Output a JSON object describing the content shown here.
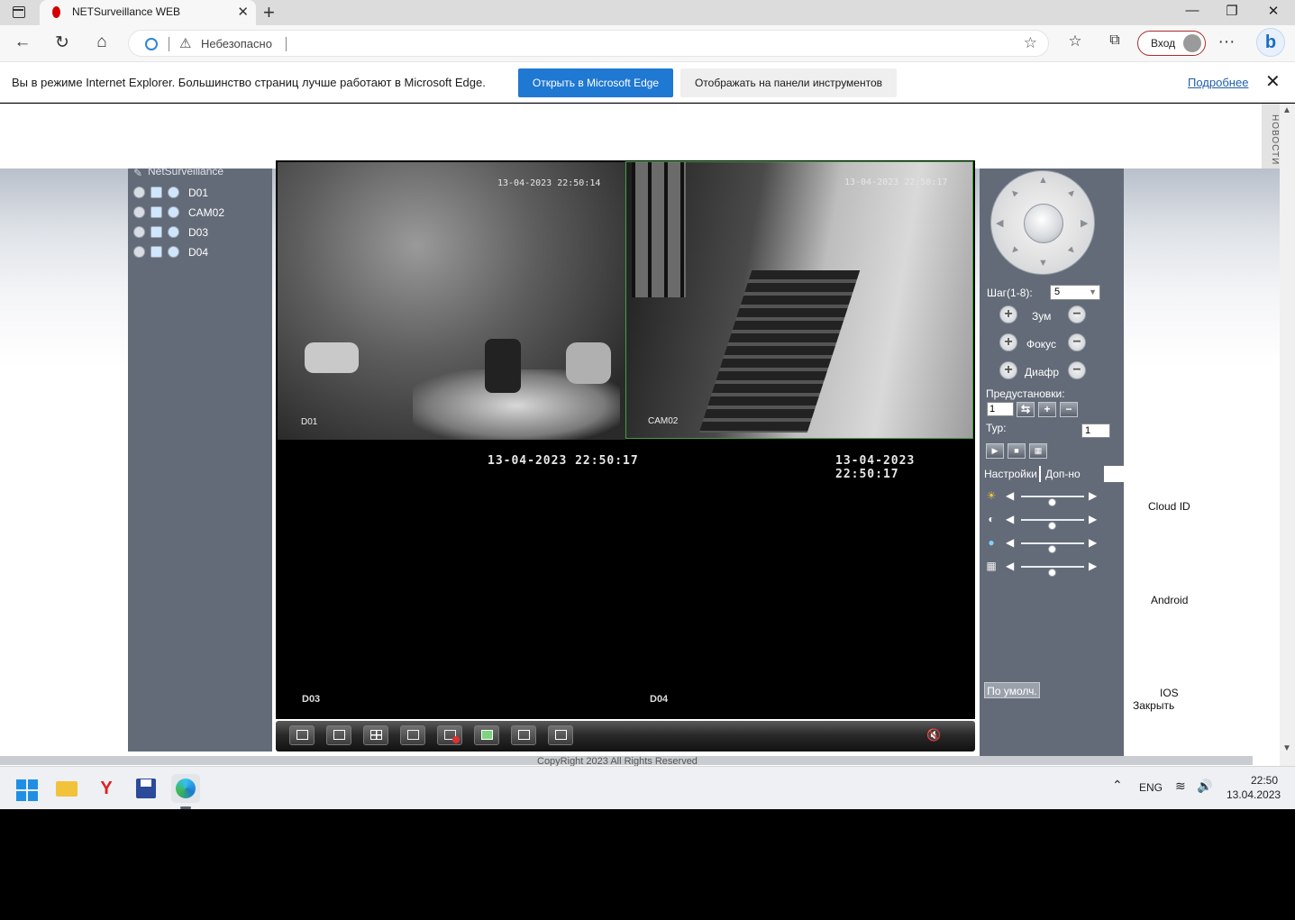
{
  "browser": {
    "tab_title": "NETSurveillance WEB",
    "tab_close": "✕",
    "new_tab": "+",
    "window_controls": {
      "minimize": "—",
      "maximize": "❐",
      "close": "✕"
    },
    "nav": {
      "back": "←",
      "refresh": "↻",
      "home": "⌂"
    },
    "address_security": "Небезопасно",
    "login_label": "Вход",
    "icons": [
      "tabs-menu-icon",
      "ie-mode-icon",
      "warning-icon",
      "favorite-add-icon",
      "favorites-icon",
      "collections-icon",
      "more-icon",
      "bing-icon"
    ],
    "more": "···"
  },
  "ie_bar": {
    "message": "Вы в режиме Internet Explorer. Большинство страниц лучше работают в Microsoft Edge.",
    "open_edge_button": "Открыть в Microsoft Edge",
    "show_toolbar_button": "Отображать на панели инструментов",
    "more_link": "Подробнее",
    "close": "✕"
  },
  "side_tab": "НОВОСТИ",
  "cameras": {
    "title": "NetSurveillance",
    "list": [
      {
        "label": "D01"
      },
      {
        "label": "CAM02"
      },
      {
        "label": "D03"
      },
      {
        "label": "D04"
      }
    ]
  },
  "video": {
    "cells": [
      {
        "name": "D01",
        "timestamp": "13-04-2023 22:50:14"
      },
      {
        "name": "CAM02",
        "timestamp": "13-04-2023 22:50:17"
      },
      {
        "name": "D03",
        "timestamp": "13-04-2023 22:50:17"
      },
      {
        "name": "D04",
        "timestamp": "13-04-2023 22:50:17"
      }
    ]
  },
  "toolbar": {
    "buttons": [
      "fullscreen",
      "single-window",
      "four-window",
      "record-all",
      "stop-record-all",
      "snapshot",
      "playback",
      "stop-playback"
    ],
    "volume_icon": "🔇"
  },
  "ptz": {
    "step_label": "Шаг(1-8):",
    "step_value": "5",
    "zoom_label": "Зум",
    "focus_label": "Фокус",
    "iris_label": "Диафр",
    "presets_label": "Предустановки:",
    "preset_value": "1",
    "tour_label": "Тур:",
    "tour_value": "1",
    "plus": "+",
    "minus": "−"
  },
  "settings": {
    "tab_settings": "Настройки",
    "tab_extra": "Доп-но",
    "sliders": [
      {
        "icon": "brightness-icon",
        "level": 0.5
      },
      {
        "icon": "contrast-icon",
        "level": 0.5
      },
      {
        "icon": "saturation-icon",
        "level": 0.5
      },
      {
        "icon": "hue-icon",
        "level": 0.5
      }
    ],
    "default_button": "По умолч."
  },
  "side_links": {
    "cloud_id": "Cloud ID",
    "android": "Android",
    "ios": "IOS",
    "close": "Закрыть"
  },
  "footer": {
    "copyright": "CopyRight 2023 All Rights Reserved"
  },
  "taskbar": {
    "language": "ENG",
    "time": "22:50",
    "date": "13.04.2023",
    "yandex": "Y"
  }
}
